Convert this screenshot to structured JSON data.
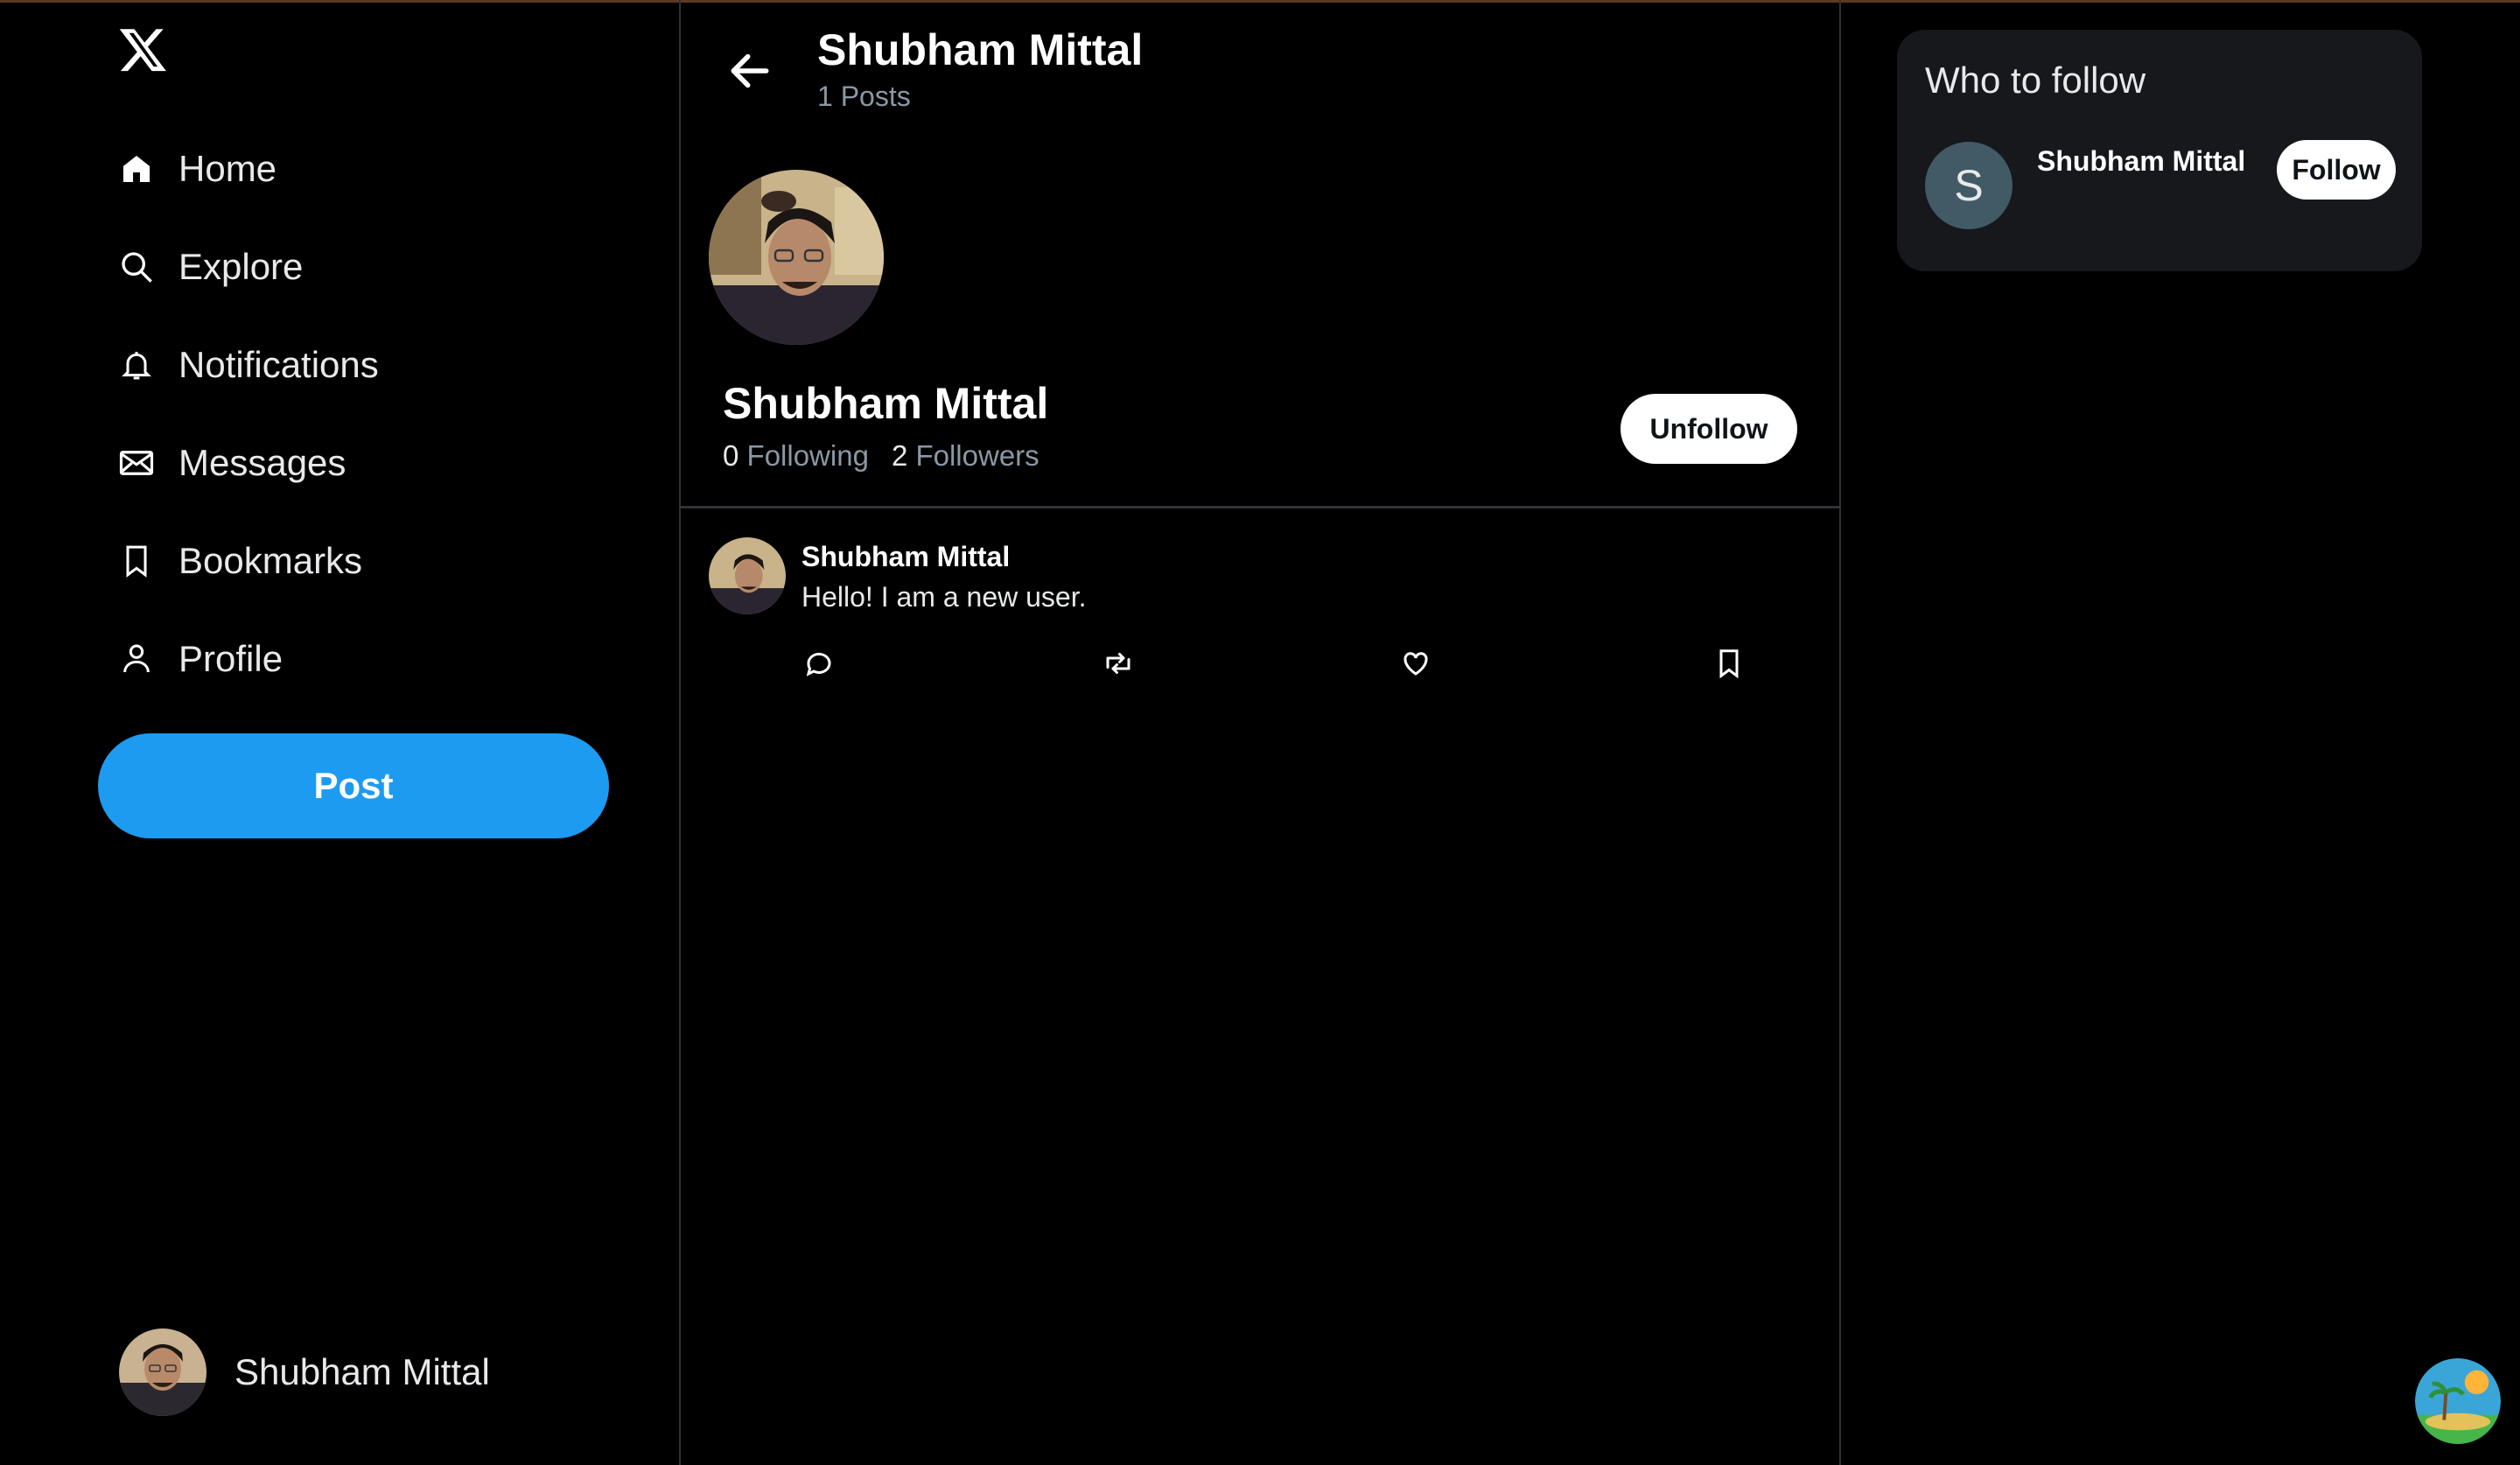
{
  "sidebar": {
    "logo": "x-logo-icon",
    "nav": [
      {
        "label": "Home",
        "icon": "home-icon"
      },
      {
        "label": "Explore",
        "icon": "search-icon"
      },
      {
        "label": "Notifications",
        "icon": "bell-icon"
      },
      {
        "label": "Messages",
        "icon": "envelope-icon"
      },
      {
        "label": "Bookmarks",
        "icon": "bookmark-icon"
      },
      {
        "label": "Profile",
        "icon": "person-icon"
      }
    ],
    "post_button": "Post",
    "account_name": "Shubham Mittal"
  },
  "header": {
    "name": "Shubham Mittal",
    "posts_count": "1 Posts"
  },
  "profile": {
    "name": "Shubham Mittal",
    "following_count": "0",
    "following_label": "Following",
    "followers_count": "2",
    "followers_label": "Followers",
    "unfollow_label": "Unfollow"
  },
  "post": {
    "author": "Shubham Mittal",
    "text": "Hello! I am a new user.",
    "actions": [
      "reply-icon",
      "repost-icon",
      "like-icon",
      "bookmark-icon"
    ]
  },
  "who_to_follow": {
    "title": "Who to follow",
    "suggestion": {
      "initial": "S",
      "name": "Shubham Mittal",
      "follow_label": "Follow"
    }
  },
  "colors": {
    "accent": "#1d9bf0",
    "border": "#2f3336",
    "muted_text": "#8b98a5",
    "card": "#16181c"
  }
}
